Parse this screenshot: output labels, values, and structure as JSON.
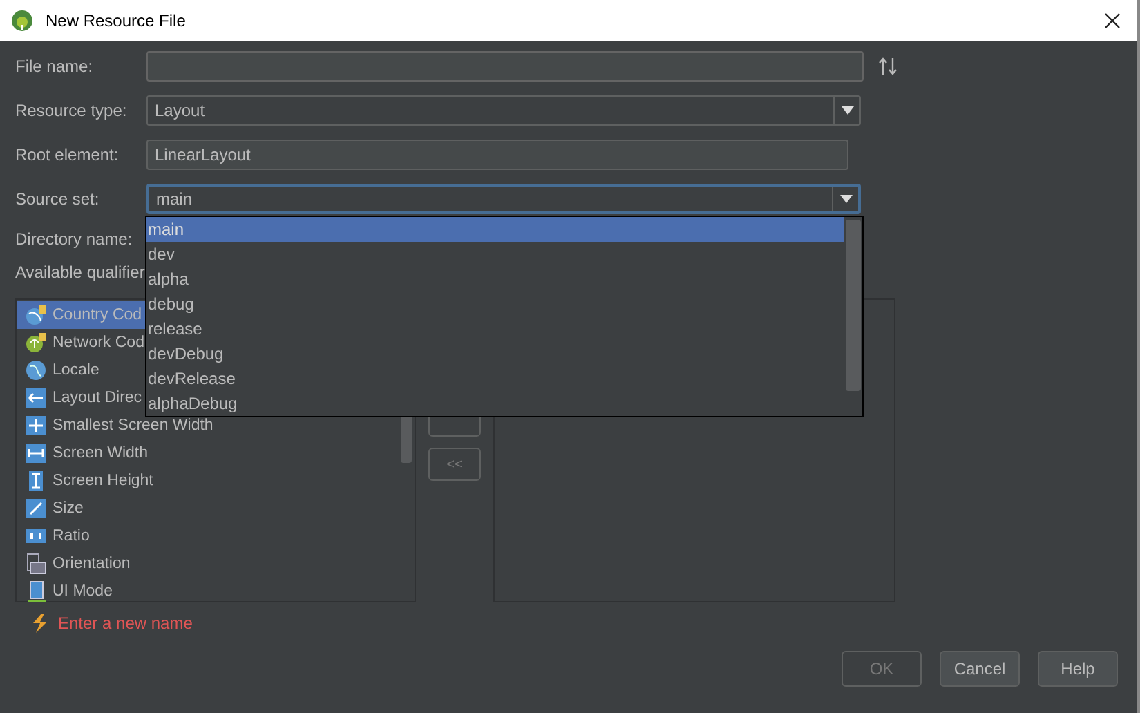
{
  "window": {
    "title": "New Resource File"
  },
  "fields": [
    {
      "kind": "text",
      "label": "File name:"
    },
    {
      "kind": "combo",
      "label": "Resource type:",
      "value": "Layout",
      "focused": false
    },
    {
      "kind": "text",
      "label": "Root element:",
      "value": "LinearLayout"
    },
    {
      "kind": "combo",
      "label": "Source set:",
      "value": "main",
      "focused": true
    }
  ],
  "directory_label": "Directory name:",
  "qualifiers_label": "Available qualifier",
  "dropdown": {
    "items": [
      {
        "label": "main",
        "selected": true
      },
      {
        "label": "dev",
        "selected": false
      },
      {
        "label": "alpha",
        "selected": false
      },
      {
        "label": "debug",
        "selected": false
      },
      {
        "label": "release",
        "selected": false
      },
      {
        "label": "devDebug",
        "selected": false
      },
      {
        "label": "devRelease",
        "selected": false
      },
      {
        "label": "alphaDebug",
        "selected": false
      }
    ]
  },
  "qualifiers": [
    {
      "label": "Country Cod",
      "kind": "country",
      "selected": true
    },
    {
      "label": "Network Cod",
      "kind": "network",
      "selected": false
    },
    {
      "label": "Locale",
      "kind": "locale",
      "selected": false
    },
    {
      "label": "Layout Direc",
      "kind": "direction",
      "selected": false
    },
    {
      "label": "Smallest Screen Width",
      "kind": "smallest",
      "selected": false
    },
    {
      "label": "Screen Width",
      "kind": "width",
      "selected": false
    },
    {
      "label": "Screen Height",
      "kind": "height",
      "selected": false
    },
    {
      "label": "Size",
      "kind": "size",
      "selected": false
    },
    {
      "label": "Ratio",
      "kind": "ratio",
      "selected": false
    },
    {
      "label": "Orientation",
      "kind": "orientation",
      "selected": false
    },
    {
      "label": "UI Mode",
      "kind": "uimode",
      "selected": false
    }
  ],
  "remove_button": "<<",
  "error": "Enter a new name",
  "buttons": [
    {
      "label": "OK",
      "disabled": true
    },
    {
      "label": "Cancel",
      "disabled": false
    },
    {
      "label": "Help",
      "disabled": false
    }
  ]
}
